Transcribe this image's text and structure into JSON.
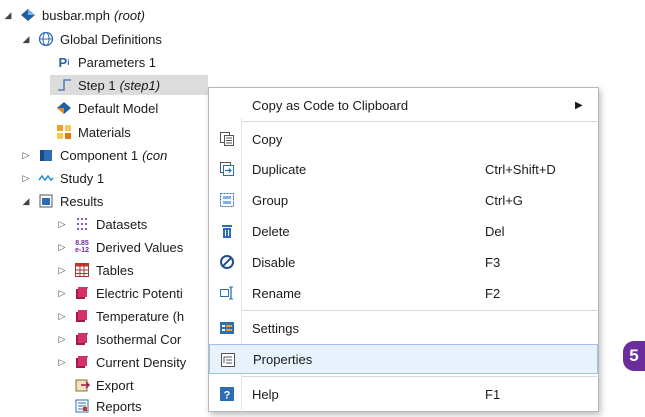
{
  "tree": {
    "root": {
      "label": "busbar.mph",
      "note": "(root)"
    },
    "global_definitions": "Global Definitions",
    "parameters": "Parameters 1",
    "step": {
      "label": "Step 1",
      "note": "(step1)"
    },
    "default_model": "Default Model",
    "materials": "Materials",
    "component": {
      "label": "Component 1",
      "note": "(con"
    },
    "study": "Study 1",
    "results": "Results",
    "datasets": "Datasets",
    "derived_values": "Derived Values",
    "tables": "Tables",
    "electric_potential": "Electric Potenti",
    "temperature": "Temperature (h",
    "isothermal": "Isothermal Cor",
    "current_density": "Current Density",
    "export": "Export",
    "reports": "Reports"
  },
  "context_menu": {
    "copy_as_code": "Copy as Code to Clipboard",
    "copy": "Copy",
    "duplicate": {
      "label": "Duplicate",
      "shortcut": "Ctrl+Shift+D"
    },
    "group": {
      "label": "Group",
      "shortcut": "Ctrl+G"
    },
    "delete": {
      "label": "Delete",
      "shortcut": "Del"
    },
    "disable": {
      "label": "Disable",
      "shortcut": "F3"
    },
    "rename": {
      "label": "Rename",
      "shortcut": "F2"
    },
    "settings": "Settings",
    "properties": "Properties",
    "help": {
      "label": "Help",
      "shortcut": "F1"
    }
  },
  "step_badge": "5",
  "colors": {
    "accent": "#6a2d9b",
    "highlight": "#e8f2fd",
    "selection": "#dcdcdc"
  }
}
